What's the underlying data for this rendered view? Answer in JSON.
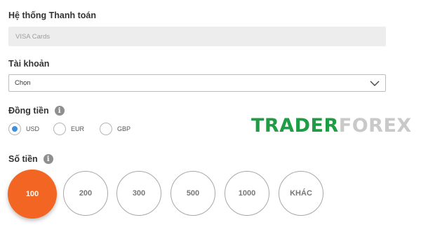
{
  "payment_system": {
    "label": "Hệ thống Thanh toán",
    "value": "VISA Cards"
  },
  "account": {
    "label": "Tài khoản",
    "selected": "Chọn"
  },
  "currency": {
    "label": "Đồng tiền",
    "info_icon": "i",
    "options": [
      "USD",
      "EUR",
      "GBP"
    ],
    "selected": "USD"
  },
  "amount": {
    "label": "Số tiền",
    "info_icon": "i",
    "options": [
      "100",
      "200",
      "300",
      "500",
      "1000",
      "KHÁC"
    ],
    "selected": "100"
  },
  "watermark": {
    "part1": "TRADER",
    "part2": "FOREX"
  },
  "colors": {
    "accent": "#f26522",
    "radio_selected": "#3d8fe0",
    "logo_green": "#1f9d44"
  }
}
